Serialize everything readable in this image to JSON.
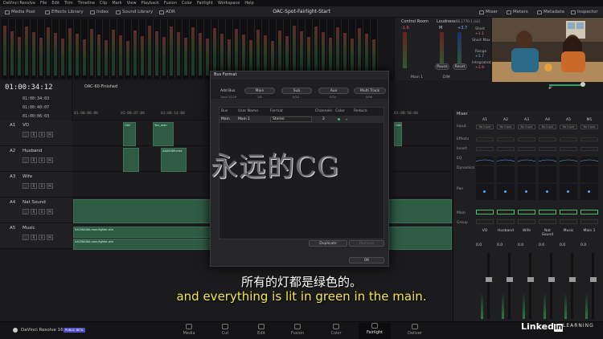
{
  "menu": [
    "DaVinci Resolve",
    "File",
    "Edit",
    "Trim",
    "Timeline",
    "Clip",
    "Mark",
    "View",
    "Playback",
    "Fusion",
    "Color",
    "Fairlight",
    "Workspace",
    "Help"
  ],
  "toolbar": {
    "media_pool": "Media Pool",
    "effects_library": "Effects Library",
    "index": "Index",
    "sound_library": "Sound Library",
    "adr": "ADR",
    "project_title": "OAC-Spot-Fairlight-Start",
    "mixer": "Mixer",
    "meters": "Meters",
    "metadata": "Metadata",
    "inspector": "Inspector"
  },
  "control_room": {
    "title": "Control Room",
    "m1": "M1",
    "val": "-1.6",
    "loudness": "Loudness",
    "standard": "BS.1770-1 (LU)",
    "short": "Short",
    "short_max": "Short Max",
    "range": "Range",
    "integrated": "Integrated",
    "short_val": "+1.1",
    "range_val": "+3.7",
    "integrated_val": "+3.9",
    "pause": "Pause",
    "reset": "Reset",
    "main1": "Main 1",
    "mute_lbl": "DIM",
    "m_lbl": "M"
  },
  "timeline": {
    "timecode": "01:00:34:12",
    "tc1": "01:00:34:03",
    "tc2": "01:00:40:07",
    "tc3": "01:00:06:03",
    "timeline_name": "OAC-60-Finished",
    "ruler": [
      "01:00:00:00",
      "01:00:07:00",
      "01:00:14:00",
      "01:00:56:00"
    ]
  },
  "tracks": [
    {
      "id": "A1",
      "name": "VO",
      "level": "2.0"
    },
    {
      "id": "A2",
      "name": "Husband",
      "level": "2.0"
    },
    {
      "id": "A3",
      "name": "Wife",
      "level": "2.0"
    },
    {
      "id": "A4",
      "name": "Nat Sound",
      "level": "2.0"
    },
    {
      "id": "A5",
      "name": "Music",
      "level": "2.0"
    }
  ],
  "clips": {
    "c1": "OAC",
    "c2": "You_man",
    "c3": "AA00069.mxs",
    "c4": "OAC",
    "c5": "0ACMA06A-mov-fighter-win",
    "c6": "0ACMA06A-mov-fighter-win"
  },
  "dialog": {
    "title": "Bus Format",
    "add_bus": "Add Bus",
    "used": "Used 2/128",
    "main": "Main",
    "main_used": "1/8",
    "sub": "Sub",
    "sub_used": "0/24",
    "aux": "Aux",
    "aux_used": "0/24",
    "multi": "Multi Track",
    "multi_used": "0/96",
    "col_bus": "Bus",
    "col_user": "User Name",
    "col_format": "Format",
    "col_channels": "Channels",
    "col_color": "Color",
    "col_reduce": "Reduce",
    "row_bus": "Main",
    "row_user": "Main 1",
    "row_format": "Stereo",
    "row_channels": "2",
    "duplicate": "Duplicate",
    "delete": "Remove",
    "ok": "OK"
  },
  "mixer": {
    "title": "Mixer",
    "channels": [
      "A1",
      "A2",
      "A3",
      "A4",
      "A5",
      "M1"
    ],
    "input": "Input",
    "no_input": "No Input",
    "effects": "Effects",
    "insert": "Insert",
    "eq": "EQ",
    "dynamics": "Dynamics",
    "pan": "Pan",
    "main": "Main",
    "group": "Group",
    "names": [
      "VO",
      "Husband",
      "Wife",
      "Nat Sound",
      "Music",
      "Main 1"
    ],
    "levels": [
      "0.0",
      "0.0",
      "0.0",
      "0.0",
      "0.0",
      "0.0"
    ]
  },
  "pages": [
    {
      "name": "Media"
    },
    {
      "name": "Cut"
    },
    {
      "name": "Edit"
    },
    {
      "name": "Fusion"
    },
    {
      "name": "Color"
    },
    {
      "name": "Fairlight"
    },
    {
      "name": "Deliver"
    }
  ],
  "app": {
    "name": "DaVinci Resolve 16",
    "badge": "PUBLIC BETA"
  },
  "subtitles": {
    "zh": "所有的灯都是绿色的。",
    "en": "and everything is lit in green in the main."
  },
  "watermark": "永远的CG",
  "brand": {
    "linked": "Linked",
    "in": "in",
    "learning": "LEARNING"
  }
}
